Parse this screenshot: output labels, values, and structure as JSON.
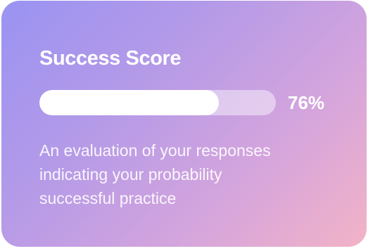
{
  "card": {
    "title": "Success Score",
    "progress_value": 0.76,
    "progress_label": "76%",
    "description": "An evaluation of your responses\nindicating your probability\nsuccessful practice"
  },
  "colors": {
    "gradient_start": "#9a93f2",
    "gradient_end": "#f2b3c6",
    "text": "#ffffff",
    "progress_fill": "#ffffff"
  }
}
